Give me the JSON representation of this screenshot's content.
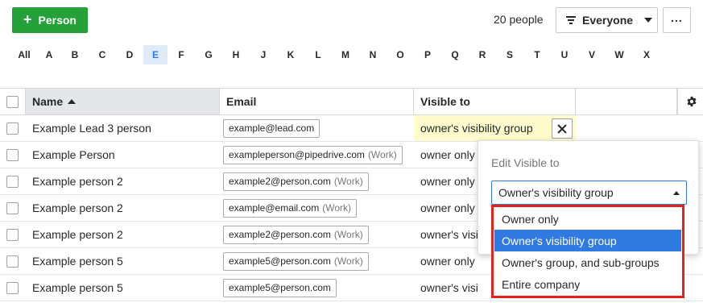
{
  "toolbar": {
    "add_label": "Person",
    "count_text": "20 people",
    "filter_label": "Everyone",
    "more_label": "..."
  },
  "alphabet": [
    "All",
    "A",
    "B",
    "C",
    "D",
    "E",
    "F",
    "G",
    "H",
    "J",
    "K",
    "L",
    "M",
    "N",
    "O",
    "P",
    "Q",
    "R",
    "S",
    "T",
    "U",
    "V",
    "W",
    "X"
  ],
  "alphabet_active": "E",
  "table": {
    "columns": [
      "Name",
      "Email",
      "Visible to"
    ],
    "rows": [
      {
        "name": "Example Lead 3 person",
        "email": "example@lead.com",
        "email_label": "",
        "visible": "owner's visibility group"
      },
      {
        "name": "Example Person",
        "email": "exampleperson@pipedrive.com",
        "email_label": "(Work)",
        "visible": "owner only"
      },
      {
        "name": "Example person 2",
        "email": "example2@person.com",
        "email_label": "(Work)",
        "visible": "owner only"
      },
      {
        "name": "Example person 2",
        "email": "example@email.com",
        "email_label": "(Work)",
        "visible": "owner only"
      },
      {
        "name": "Example person 2",
        "email": "example2@person.com",
        "email_label": "(Work)",
        "visible": "owner's visi"
      },
      {
        "name": "Example person 5",
        "email": "example5@person.com",
        "email_label": "(Work)",
        "visible": "owner only"
      },
      {
        "name": "Example person 5",
        "email": "example5@person.com",
        "email_label": "",
        "visible": "owner's visi"
      }
    ]
  },
  "popover": {
    "title": "Edit Visible to",
    "selected": "Owner's visibility group",
    "options": [
      "Owner only",
      "Owner's visibility group",
      "Owner's group, and sub-groups",
      "Entire company"
    ]
  },
  "colors": {
    "primary_green": "#25a13a",
    "accent_blue": "#317ae2",
    "highlight_red": "#e2231a",
    "edit_yellow": "#fffbcc"
  }
}
